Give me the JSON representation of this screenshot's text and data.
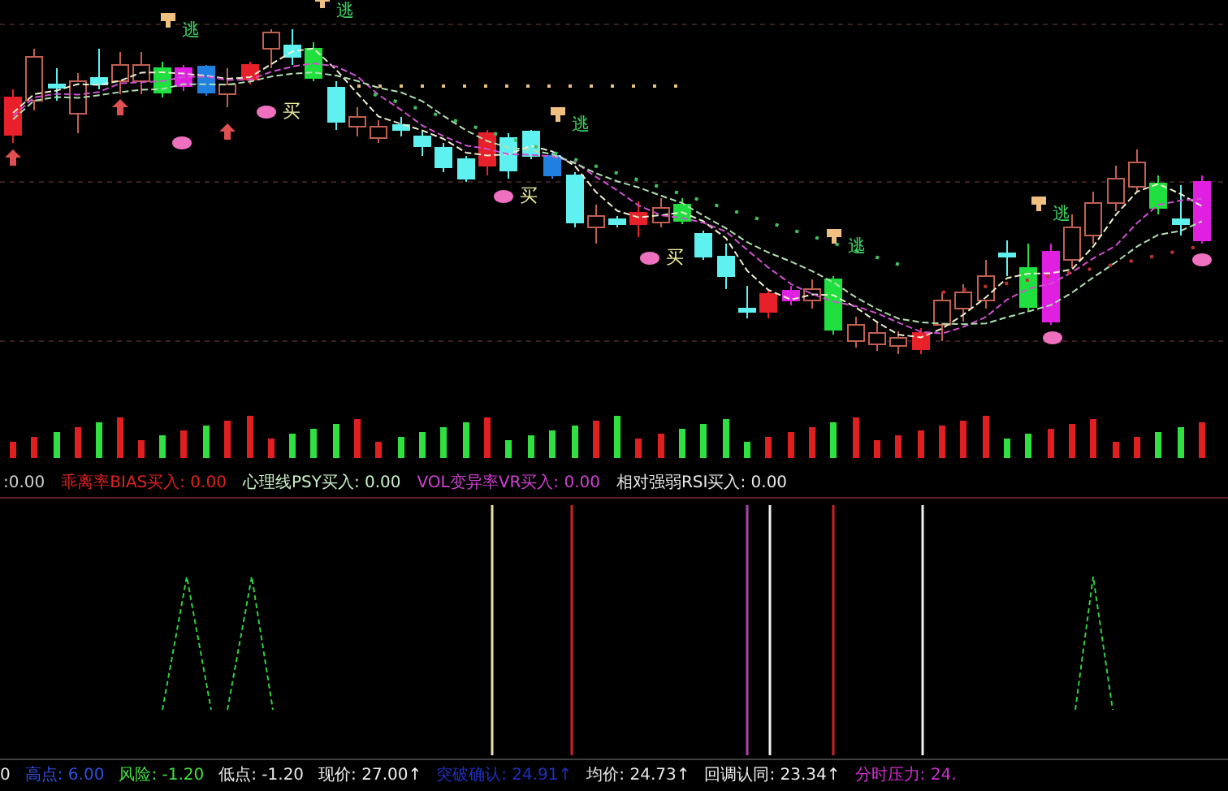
{
  "chart_signals": [
    {
      "kind": "escape",
      "label": "逃"
    },
    {
      "kind": "escape",
      "label": "逃"
    },
    {
      "kind": "buy",
      "label": "买"
    },
    {
      "kind": "escape",
      "label": "逃"
    },
    {
      "kind": "buy",
      "label": "买"
    },
    {
      "kind": "buy",
      "label": "买"
    },
    {
      "kind": "escape",
      "label": "逃"
    },
    {
      "kind": "escape",
      "label": "逃"
    }
  ],
  "indicator_header": [
    {
      "text": ":0.00",
      "color": "#d0d0d0"
    },
    {
      "text": "乖离率BIAS买入: 0.00",
      "color": "#e02020"
    },
    {
      "text": "心理线PSY买入: 0.00",
      "color": "#c8f0c8"
    },
    {
      "text": "VOL变异率VR买入: 0.00",
      "color": "#d040d0"
    },
    {
      "text": "相对强弱RSI买入: 0.00",
      "color": "#e8e8e8"
    }
  ],
  "status_bar": [
    {
      "text": "0",
      "color": "#e8e8e8"
    },
    {
      "text": "高点: 6.00",
      "color": "#3050e0"
    },
    {
      "text": "风险: -1.20",
      "color": "#40e040"
    },
    {
      "text": "低点: -1.20",
      "color": "#e8e8e8"
    },
    {
      "text": "现价: 27.00↑",
      "color": "#f0f0f0"
    },
    {
      "text": "突破确认: 24.91↑",
      "color": "#2030c0"
    },
    {
      "text": "均价: 24.73↑",
      "color": "#e8e8e8"
    },
    {
      "text": "回调认同: 23.34↑",
      "color": "#f0f0f0"
    },
    {
      "text": "分时压力: 24.",
      "color": "#d030d0"
    }
  ]
}
